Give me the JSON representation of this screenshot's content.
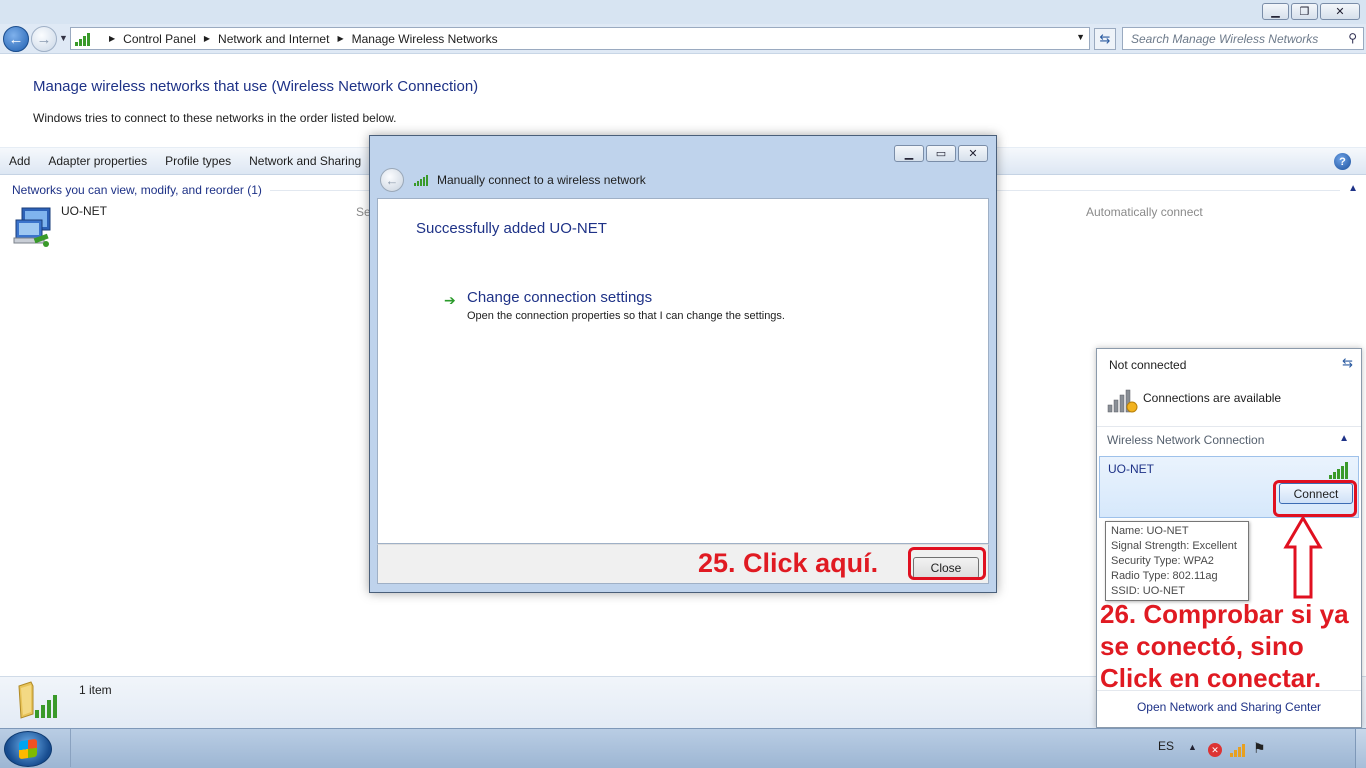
{
  "explorer": {
    "breadcrumb": [
      "Control Panel",
      "Network and Internet",
      "Manage Wireless Networks"
    ],
    "search_placeholder": "Search Manage Wireless Networks",
    "heading": "Manage wireless networks that use (Wireless Network Connection)",
    "subtext": "Windows tries to connect to these networks in the order listed below.",
    "commands": [
      "Add",
      "Adapter properties",
      "Profile types",
      "Network and Sharing"
    ],
    "help_label": "?",
    "group_header": "Networks you can view, modify, and reorder (1)",
    "network": {
      "name": "UO-NET",
      "col_hint": "Se",
      "mode": "Automatically connect"
    },
    "status_count": "1 item"
  },
  "dialog": {
    "title": "Manually connect to a wireless network",
    "success": "Successfully added UO-NET",
    "link_label": "Change connection settings",
    "link_description": "Open the connection properties so that I can change the settings.",
    "close_label": "Close"
  },
  "flyout": {
    "status": "Not connected",
    "availability": "Connections are available",
    "section": "Wireless Network Connection",
    "network_name": "UO-NET",
    "connect_label": "Connect",
    "tooltip": [
      "Name: UO-NET",
      "Signal Strength: Excellent",
      "Security Type: WPA2",
      "Radio Type: 802.11ag",
      "SSID: UO-NET"
    ],
    "footer_link": "Open Network and Sharing Center"
  },
  "annotations": {
    "step25": "25. Click aquí.",
    "step26": [
      "26. Comprobar si ya",
      "se conectó, sino",
      "Click en conectar."
    ],
    "highlight_color": "#e01a22"
  },
  "taskbar": {
    "language": "ES"
  },
  "icons": {
    "back": "back-arrow-icon",
    "forward": "forward-arrow-icon",
    "search": "search-icon",
    "refresh": "refresh-icon",
    "help": "help-icon",
    "signal": "signal-bars-icon"
  }
}
